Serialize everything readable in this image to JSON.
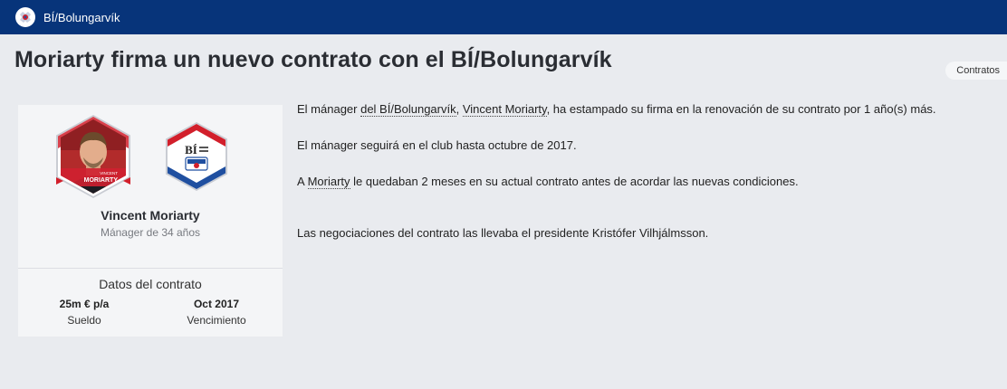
{
  "header": {
    "club_name": "BÍ/Bolungarvík",
    "crest_icon": "club-crest-icon"
  },
  "page_title": "Moriarty firma un nuevo contrato con el BÍ/Bolungarvík",
  "category_tag": "Contratos",
  "card": {
    "manager_photo_icon": "manager-photo-icon",
    "manager_badge_first": "VINCENT",
    "manager_badge_last": "MORIARTY",
    "club_badge_text": "BÍ",
    "name": "Vincent Moriarty",
    "subtitle": "Mánager de 34 años",
    "contract_section_title": "Datos del contrato",
    "salary_value": "25m € p/a",
    "salary_label": "Sueldo",
    "expiry_value": "Oct 2017",
    "expiry_label": "Vencimiento"
  },
  "article": {
    "p1_pre": "El mánager ",
    "p1_club_link": "del BÍ/Bolungarvík",
    "p1_sep": ", ",
    "p1_manager_link": "Vincent Moriarty",
    "p1_post": ", ha estampado su firma en la renovación de su contrato por 1 año(s) más.",
    "p2": "El mánager seguirá en el club hasta octubre de 2017.",
    "p3_pre": "A ",
    "p3_link": "Moriarty",
    "p3_post": " le quedaban 2 meses en su actual contrato antes de acordar las nuevas condiciones.",
    "p4": "Las negociaciones del contrato las llevaba el presidente Kristófer Vilhjálmsson."
  },
  "colors": {
    "header_bg": "#07347a",
    "page_bg": "#e9ebef",
    "card_bg": "#f4f5f7",
    "accent_red": "#d21f2b",
    "accent_blue": "#1f4fa0"
  }
}
